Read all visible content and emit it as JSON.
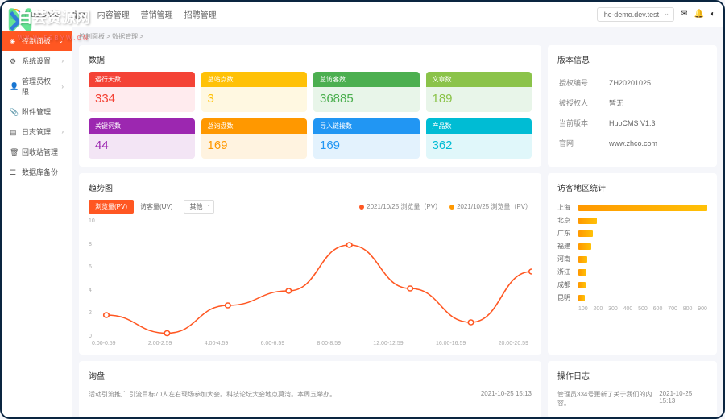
{
  "brand": "HuoCMS",
  "watermark": {
    "title": "白芸资源网",
    "sub": "WWW.52BYW.CN"
  },
  "topnav": [
    "首页",
    "内容管理",
    "营销管理",
    "招聘管理"
  ],
  "domain": "hc-demo.dev.test",
  "sidebar": [
    {
      "label": "控制面板",
      "icon": "dashboard",
      "active": true,
      "caret": true
    },
    {
      "label": "系统设置",
      "icon": "gear",
      "caret": true
    },
    {
      "label": "管理员权限",
      "icon": "user",
      "caret": true
    },
    {
      "label": "附件管理",
      "icon": "paperclip"
    },
    {
      "label": "日志管理",
      "icon": "file",
      "caret": true
    },
    {
      "label": "回收站管理",
      "icon": "trash"
    },
    {
      "label": "数据库备份",
      "icon": "database"
    }
  ],
  "crumb": "控制面板 > 数据管理 >",
  "data_title": "数据",
  "stats": [
    {
      "label": "运行天数",
      "value": "334"
    },
    {
      "label": "总站点数",
      "value": "3"
    },
    {
      "label": "总访客数",
      "value": "36885"
    },
    {
      "label": "文章数",
      "value": "189"
    },
    {
      "label": "关键词数",
      "value": "44"
    },
    {
      "label": "总询盘数",
      "value": "169"
    },
    {
      "label": "导入链接数",
      "value": "169"
    },
    {
      "label": "产品数",
      "value": "362"
    }
  ],
  "version_title": "版本信息",
  "version": [
    {
      "k": "授权编号",
      "v": "ZH20201025"
    },
    {
      "k": "被授权人",
      "v": "暂无"
    },
    {
      "k": "当前版本",
      "v": "HuoCMS V1.3"
    },
    {
      "k": "官网",
      "v": "www.zhco.com"
    }
  ],
  "trend_title": "趋势图",
  "tabs": [
    {
      "label": "浏览量(PV)",
      "active": true
    },
    {
      "label": "访客量(UV)"
    }
  ],
  "tab_other": "其他",
  "legend": [
    {
      "label": "2021/10/25 浏览量（PV）",
      "color": "#ff5722"
    },
    {
      "label": "2021/10/25 浏览量（PV）",
      "color": "#ff9800"
    }
  ],
  "chart_data": {
    "type": "line",
    "title": "趋势图",
    "xlabel": "",
    "ylabel": "",
    "x": [
      "0:00-0:59",
      "2:00-2:59",
      "4:00-4:59",
      "6:00-6:59",
      "8:00-8:59",
      "12:00-12:59",
      "16:00-16:59",
      "20:00-20:59"
    ],
    "yticks": [
      0,
      2,
      4,
      6,
      8,
      10
    ],
    "ylim": [
      0,
      10
    ],
    "series": [
      {
        "name": "2021/10/25 浏览量（PV）",
        "values": [
          2,
          0.5,
          2.8,
          4,
          7.8,
          4.2,
          1.4,
          5.6
        ]
      }
    ]
  },
  "region_title": "访客地区统计",
  "region_chart": {
    "type": "bar",
    "categories": [
      "上海",
      "北京",
      "广东",
      "福建",
      "河南",
      "浙江",
      "成都",
      "昆明"
    ],
    "values": [
      900,
      130,
      100,
      90,
      60,
      55,
      50,
      45
    ],
    "xlim": [
      0,
      900
    ],
    "xticks": [
      100,
      200,
      300,
      400,
      500,
      600,
      700,
      800,
      900
    ]
  },
  "inquiry_title": "询盘",
  "inquiry": [
    {
      "text": "活动引流推广 引流目标70人左右现场参加大会。科技论坛大会地点莫湾。本周五举办。",
      "time": "2021-10-25 15:13"
    }
  ],
  "oplog_title": "操作日志",
  "oplog": [
    {
      "text": "管理员334号更新了关于我们的内容。",
      "time": "2021-10-25 15:13"
    }
  ]
}
